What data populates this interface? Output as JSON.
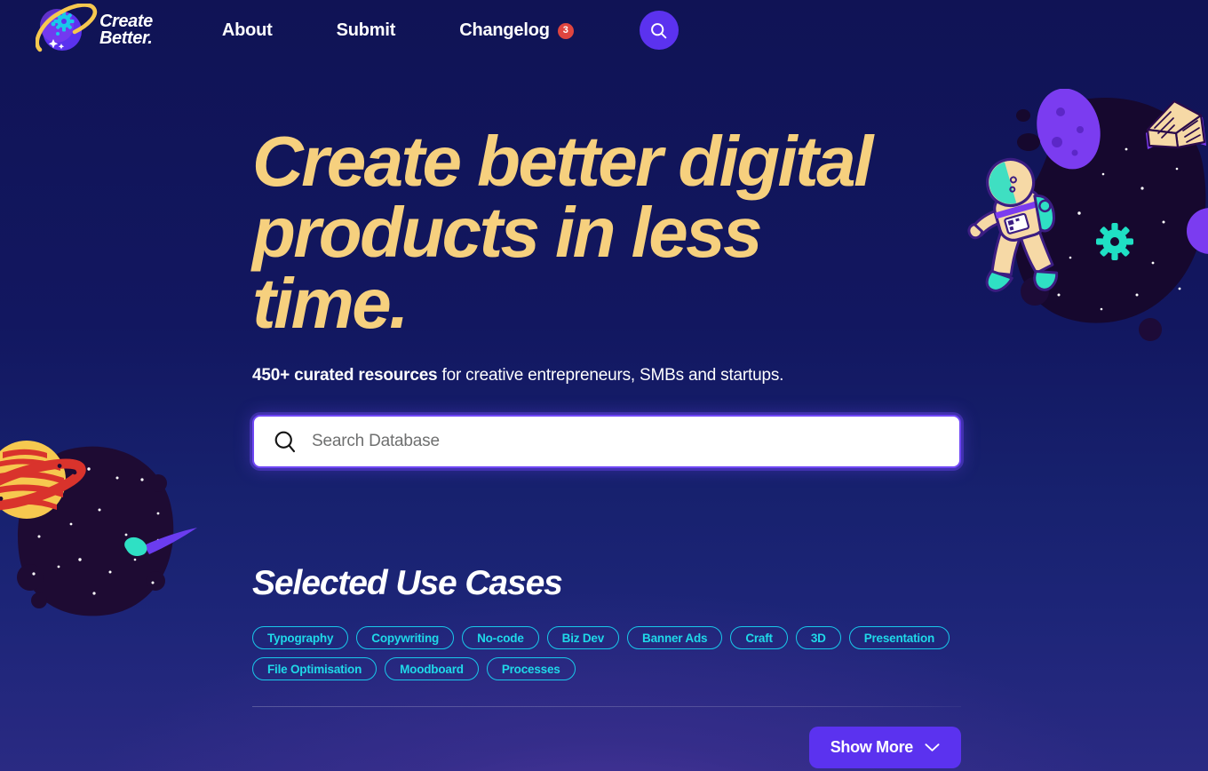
{
  "brand": {
    "name_line1": "Create",
    "name_line2": "Better.",
    "logo_icon": "planet-logo-icon",
    "accent_purple": "#5b32ef",
    "accent_yellow": "#f6d07e",
    "accent_cyan": "#1fd9e8",
    "badge_red": "#e0453f",
    "bg_top": "#101355",
    "bg_bottom": "#2a2a83"
  },
  "nav": {
    "items": [
      {
        "label": "About"
      },
      {
        "label": "Submit"
      },
      {
        "label": "Changelog",
        "badge": "3"
      }
    ],
    "search_button_icon": "search-icon"
  },
  "hero": {
    "headline_line1": "Create better digital",
    "headline_line2": "products in less time.",
    "subhead_strong": "450+ curated resources",
    "subhead_rest": " for creative entrepreneurs, SMBs and startups."
  },
  "search": {
    "icon": "search-icon",
    "placeholder": "Search Database",
    "value": ""
  },
  "use_cases": {
    "title": "Selected Use Cases",
    "tags": [
      {
        "label": "Typography"
      },
      {
        "label": "Copywriting"
      },
      {
        "label": "No-code"
      },
      {
        "label": "Biz Dev"
      },
      {
        "label": "Banner Ads"
      },
      {
        "label": "Craft"
      },
      {
        "label": "3D"
      },
      {
        "label": "Presentation"
      },
      {
        "label": "File Optimisation"
      },
      {
        "label": "Moodboard"
      },
      {
        "label": "Processes"
      }
    ],
    "show_more_label": "Show More",
    "show_more_icon": "chevron-down-icon"
  },
  "decor": {
    "right_scene": "astronaut-space-scene",
    "left_scene": "planet-comet-space-scene"
  }
}
